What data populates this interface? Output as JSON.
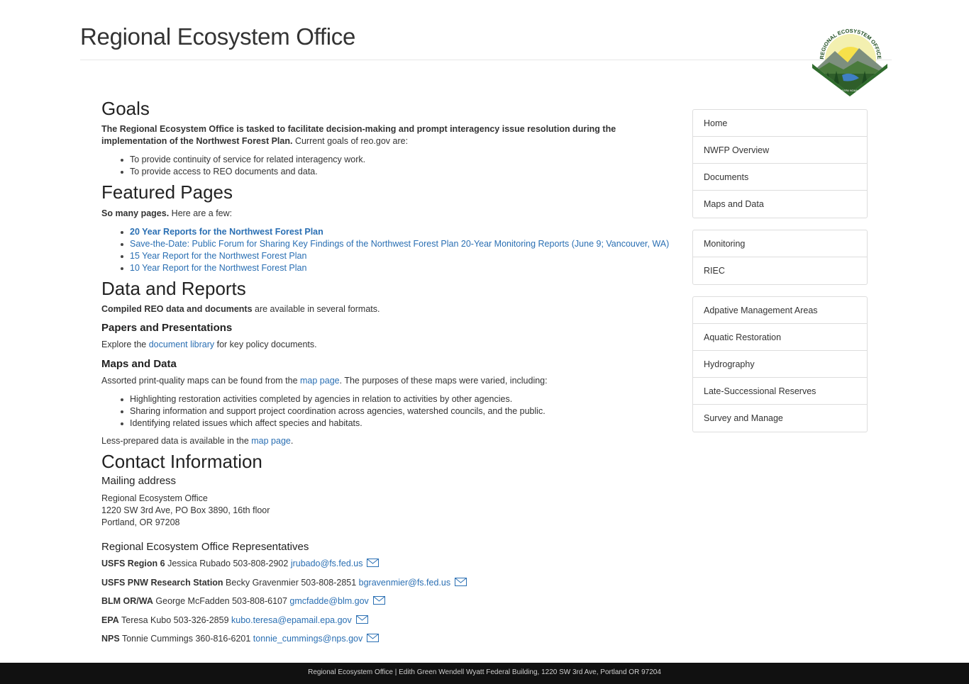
{
  "header": {
    "title": "Regional Ecosystem Office"
  },
  "goals": {
    "heading": "Goals",
    "intro_bold": "The Regional Ecosystem Office is tasked to facilitate decision-making and prompt interagency issue resolution during the implementation of the Northwest Forest Plan.",
    "intro_rest": " Current goals of reo.gov are:",
    "items": [
      "To provide continuity of service for related interagency work.",
      "To provide access to REO documents and data."
    ]
  },
  "featured": {
    "heading": "Featured Pages",
    "intro_bold": "So many pages.",
    "intro_rest": " Here are a few:",
    "links": [
      "20 Year Reports for the Northwest Forest Plan",
      "Save-the-Date: Public Forum for Sharing Key Findings of the Northwest Forest Plan 20-Year Monitoring Reports (June 9; Vancouver, WA)",
      "15 Year Report for the Northwest Forest Plan",
      "10 Year Report for the Northwest Forest Plan"
    ]
  },
  "data_reports": {
    "heading": "Data and Reports",
    "intro_bold": "Compiled REO data and documents",
    "intro_rest": " are available in several formats.",
    "papers": {
      "heading": "Papers and Presentations",
      "pre": "Explore the ",
      "link": "document library",
      "post": " for key policy documents."
    },
    "maps": {
      "heading": "Maps and Data",
      "pre": "Assorted print-quality maps can be found from the ",
      "link": "map page",
      "post": ". The purposes of these maps were varied, including:",
      "items": [
        "Highlighting restoration activities completed by agencies in relation to activities by other agencies.",
        "Sharing information and support project coordination across agencies, watershed councils, and the public.",
        "Identifying related issues which affect species and habitats."
      ],
      "less_pre": "Less-prepared data is available in the ",
      "less_link": "map page",
      "less_post": "."
    }
  },
  "contact": {
    "heading": "Contact Information",
    "mailing_heading": "Mailing address",
    "address": [
      "Regional Ecosystem Office",
      "1220 SW 3rd Ave, PO Box 3890, 16th floor",
      "Portland, OR 97208"
    ],
    "reps_heading": "Regional Ecosystem Office Representatives",
    "reps": [
      {
        "agency": "USFS Region 6",
        "name": " Jessica Rubado 503-808-2902 ",
        "email": "jrubado@fs.fed.us"
      },
      {
        "agency": "USFS PNW Research Station",
        "name": " Becky Gravenmier 503-808-2851 ",
        "email": "bgravenmier@fs.fed.us"
      },
      {
        "agency": "BLM OR/WA",
        "name": " George McFadden 503-808-6107 ",
        "email": "gmcfadde@blm.gov"
      },
      {
        "agency": "EPA",
        "name": " Teresa Kubo 503-326-2859 ",
        "email": "kubo.teresa@epamail.epa.gov"
      },
      {
        "agency": "NPS",
        "name": " Tonnie Cummings 360-816-6201 ",
        "email": "tonnie_cummings@nps.gov"
      }
    ]
  },
  "sidebar": {
    "group1": [
      "Home",
      "NWFP Overview",
      "Documents",
      "Maps and Data"
    ],
    "group2": [
      "Monitoring",
      "RIEC"
    ],
    "group3": [
      "Adpative Management Areas",
      "Aquatic Restoration",
      "Hydrography",
      "Late-Successional Reserves",
      "Survey and Manage"
    ]
  },
  "logo": {
    "top_text": "REGIONAL ECOSYSTEM OFFICE",
    "banner": "USDA BLM EPA NOAA FWS NPS"
  },
  "footer": {
    "text": "Regional Ecosystem Office | Edith Green Wendell Wyatt Federal Building, 1220 SW 3rd Ave, Portland OR 97204"
  },
  "colors": {
    "link": "#2a6fb3",
    "footer_bg": "#111111",
    "border": "#dddddd"
  }
}
